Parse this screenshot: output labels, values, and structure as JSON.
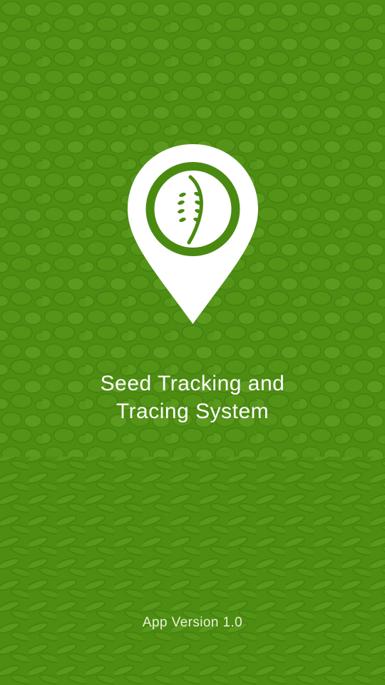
{
  "splash": {
    "title_line1": "Seed Tracking and",
    "title_line2": "Tracing System",
    "version_text": "App Version 1.0"
  },
  "logo": {
    "icon": "seed-location-pin-icon"
  },
  "colors": {
    "background_green": "#4a8a10",
    "overlay_green": "#5a9a1a",
    "seed_dark": "#3e7a0c",
    "text": "#ffffff"
  }
}
